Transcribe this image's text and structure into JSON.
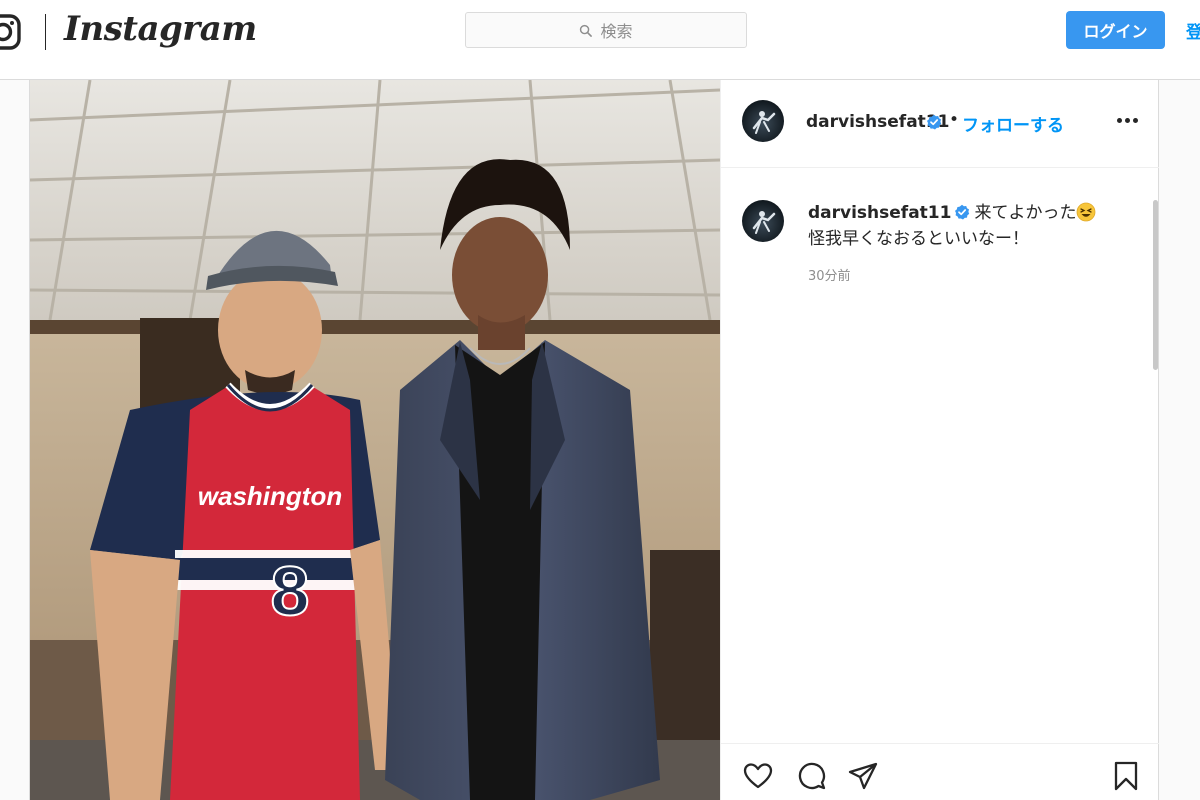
{
  "nav": {
    "brand": "Instagram",
    "search_placeholder": "検索",
    "login_label": "ログイン",
    "signup_label": "登録"
  },
  "post": {
    "username": "darvishsefat11",
    "follow_label": "フォローする",
    "dot_separator": "•",
    "caption_line1": "来てよかった",
    "caption_line2": "怪我早くなおるといいなー！",
    "timestamp": "30分前",
    "jersey_text": "washington",
    "jersey_number": "8"
  },
  "colors": {
    "accent": "#0095f6",
    "login_bg": "#3897f0",
    "verified": "#3897f0"
  },
  "icons": [
    "instagram-glyph-icon",
    "search-icon",
    "verified-badge-icon",
    "more-options-icon",
    "laughing-emoji-icon",
    "heart-icon",
    "comment-icon",
    "share-icon",
    "bookmark-icon"
  ]
}
